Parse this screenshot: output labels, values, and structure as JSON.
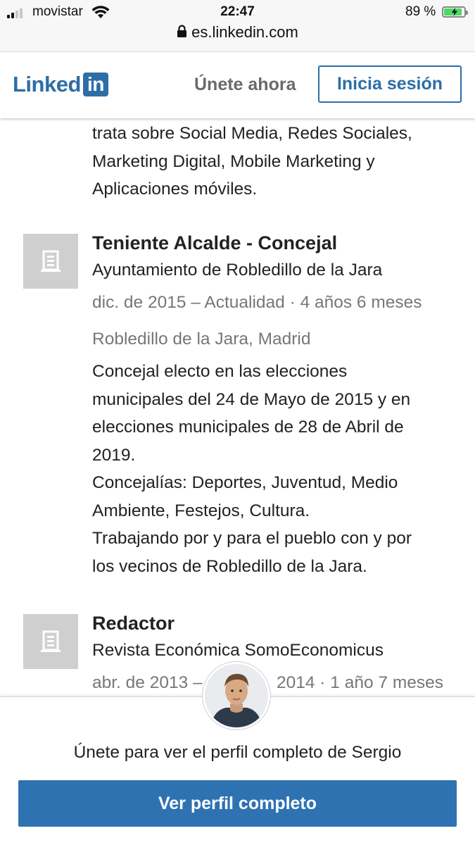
{
  "status_bar": {
    "carrier": "movistar",
    "time": "22:47",
    "battery_percent": "89 %",
    "battery_level": 0.89
  },
  "browser": {
    "url": "es.linkedin.com"
  },
  "header": {
    "logo_text": "Linked",
    "logo_box_text": "in",
    "join_now": "Únete ahora",
    "sign_in": "Inicia sesión",
    "brand_color": "#2e6ea6"
  },
  "profile": {
    "partial_description": [
      "trata sobre Social Media, Redes Sociales,",
      "Marketing Digital, Mobile Marketing y",
      "Aplicaciones móviles."
    ],
    "experience": [
      {
        "title": "Teniente Alcalde - Concejal",
        "company": "Ayuntamiento de Robledillo de la Jara",
        "dates": "dic. de 2015 – Actualidad · 4 años 6 meses",
        "location": "Robledillo de la Jara, Madrid",
        "description": [
          "Concejal electo en las elecciones",
          "municipales del 24 de Mayo de 2015 y en",
          "elecciones municipales de 28 de Abril de",
          "2019.",
          "Concejalías: Deportes, Juventud, Medio",
          "Ambiente, Festejos, Cultura.",
          "Trabajando por y para el pueblo con y por",
          "los vecinos de Robledillo de la Jara."
        ],
        "icon": "building-icon"
      },
      {
        "title": "Redactor",
        "company": "Revista Económica SomoEconomicus",
        "dates_start": "abr. de 2013 –",
        "dates_end": "2014 · 1 año 7 meses",
        "icon": "building-icon"
      }
    ]
  },
  "join_overlay": {
    "message": "Únete para ver el perfil completo de Sergio",
    "button": "Ver perfil completo",
    "button_color": "#2e72b2"
  }
}
